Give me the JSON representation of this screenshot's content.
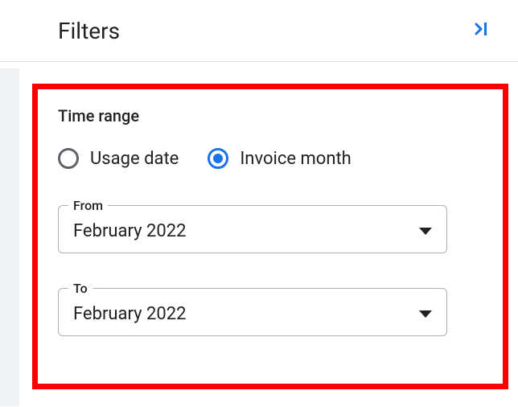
{
  "header": {
    "title": "Filters"
  },
  "section": {
    "title": "Time range",
    "radios": {
      "usage_date_label": "Usage date",
      "invoice_month_label": "Invoice month",
      "selected": "invoice_month"
    },
    "from": {
      "legend": "From",
      "value": "February 2022"
    },
    "to": {
      "legend": "To",
      "value": "February 2022"
    }
  }
}
